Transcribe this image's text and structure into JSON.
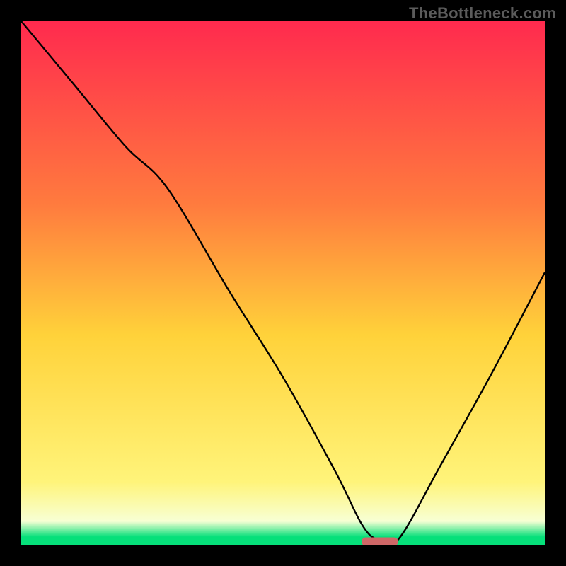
{
  "watermark": "TheBottleneck.com",
  "colors": {
    "background": "#000000",
    "watermark_text": "#5b5b5b",
    "curve": "#000000",
    "marker": "#cf6767",
    "grad_top": "#ff2a4e",
    "grad_mid_upper": "#ff7b3e",
    "grad_mid": "#ffd23a",
    "grad_lower": "#fff47a",
    "grad_pale": "#f7ffd4",
    "grad_green": "#06e07a"
  },
  "chart_data": {
    "type": "line",
    "title": "",
    "xlabel": "",
    "ylabel": "",
    "xlim": [
      0,
      100
    ],
    "ylim": [
      0,
      100
    ],
    "series": [
      {
        "name": "bottleneck-curve",
        "x": [
          0,
          10,
          20,
          28,
          40,
          50,
          60,
          65,
          68,
          72,
          80,
          90,
          100
        ],
        "y": [
          100,
          88,
          76,
          68,
          48,
          32,
          14,
          4,
          1,
          1,
          15,
          33,
          52
        ]
      }
    ],
    "marker": {
      "x_start": 65,
      "x_end": 72,
      "y": 0.6
    },
    "gradient_stops": [
      {
        "offset": 0.0,
        "key": "grad_top"
      },
      {
        "offset": 0.35,
        "key": "grad_mid_upper"
      },
      {
        "offset": 0.6,
        "key": "grad_mid"
      },
      {
        "offset": 0.88,
        "key": "grad_lower"
      },
      {
        "offset": 0.955,
        "key": "grad_pale"
      },
      {
        "offset": 0.985,
        "key": "grad_green"
      },
      {
        "offset": 1.0,
        "key": "grad_green"
      }
    ]
  }
}
